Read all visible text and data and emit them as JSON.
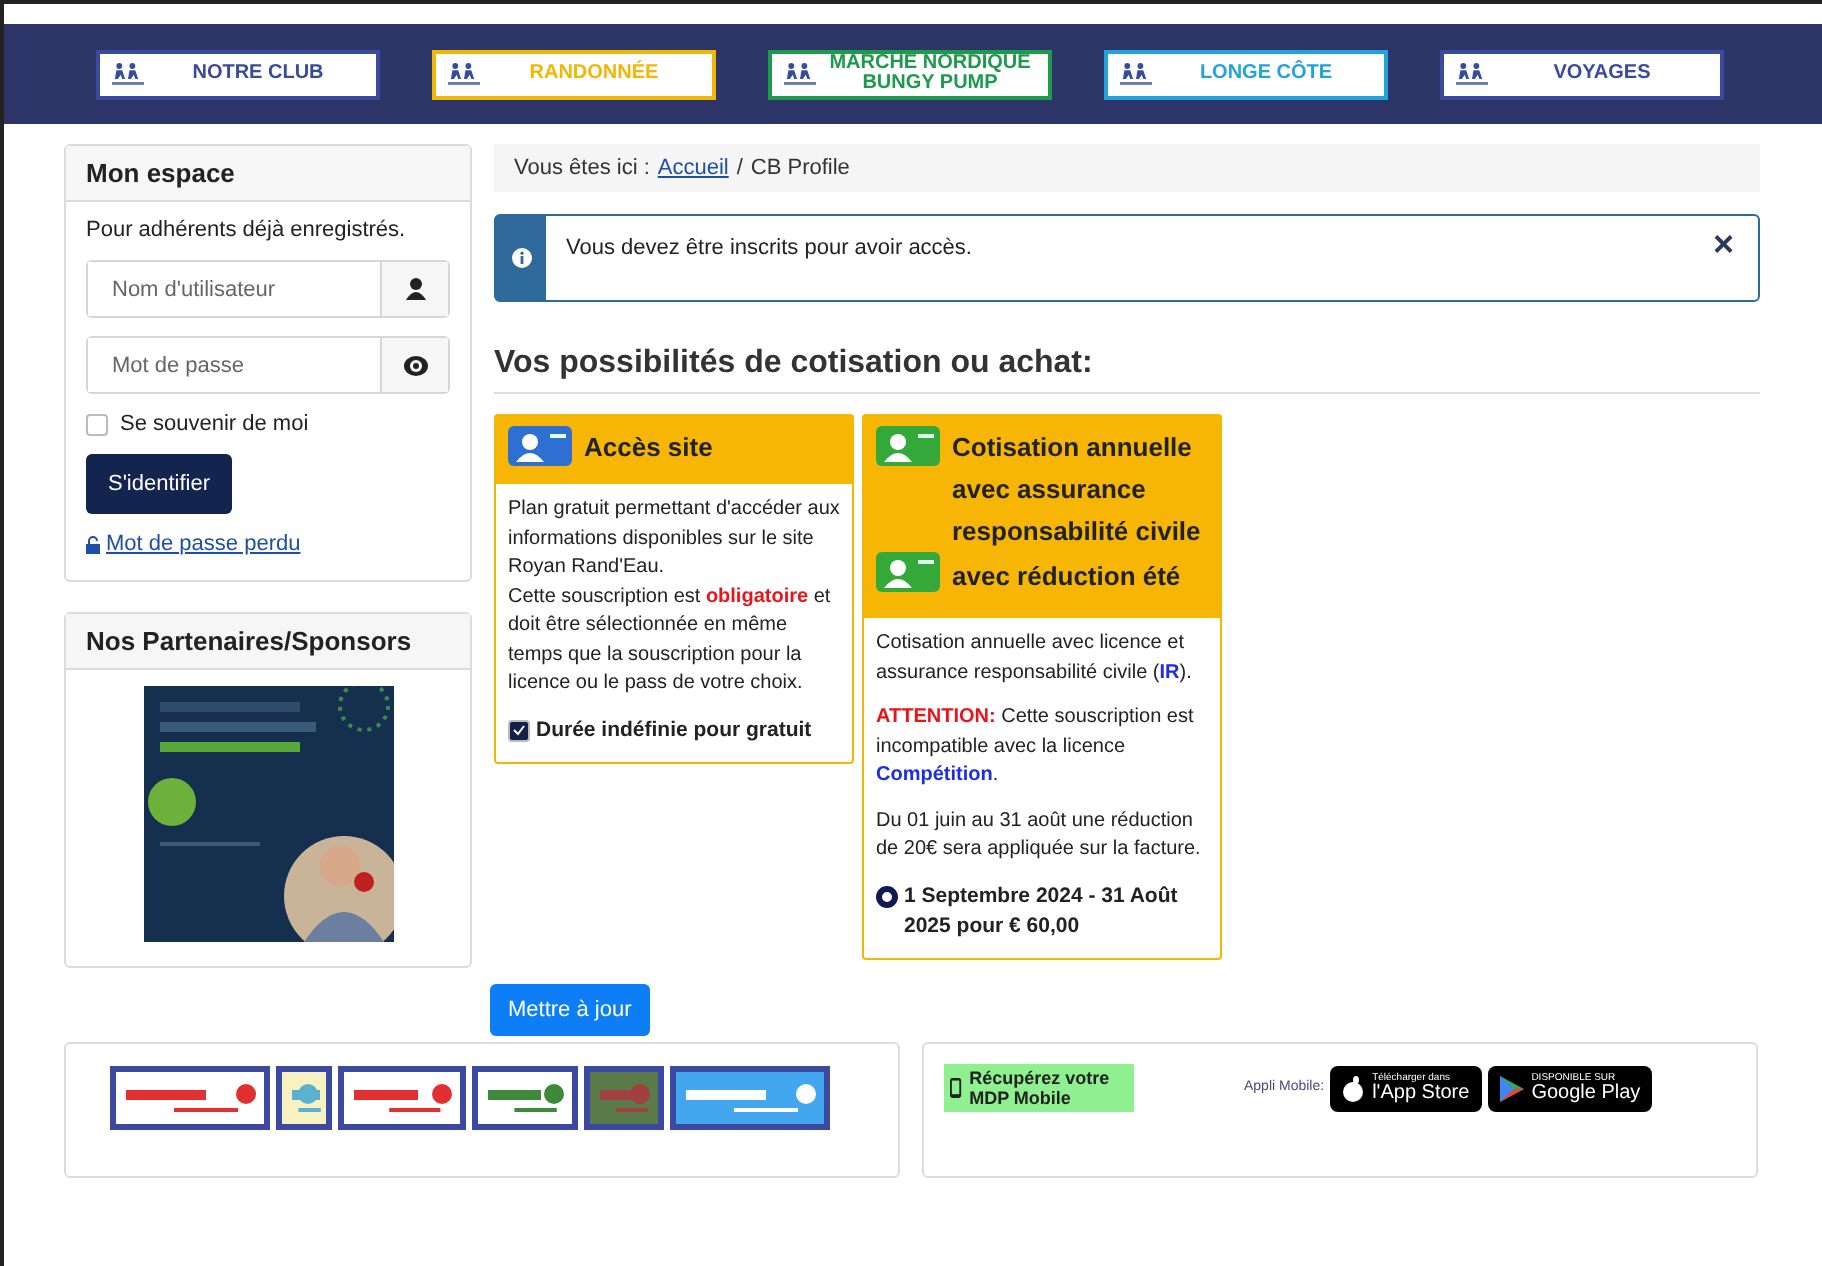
{
  "nav": [
    {
      "label": "NOTRE CLUB",
      "color": "#3a4a9c"
    },
    {
      "label": "RANDONNÉE",
      "color": "#f2b705"
    },
    {
      "label": "MARCHE NORDIQUE BUNGY PUMP",
      "color": "#1e9a4c"
    },
    {
      "label": "LONGE CÔTE",
      "color": "#22a3dc"
    },
    {
      "label": "VOYAGES",
      "color": "#3a4a9c"
    }
  ],
  "login": {
    "title": "Mon espace",
    "intro": "Pour adhérents déjà enregistrés.",
    "username": {
      "placeholder": "Nom d'utilisateur"
    },
    "password": {
      "placeholder": "Mot de passe"
    },
    "remember": {
      "label": "Se souvenir de moi",
      "checked": false
    },
    "submit": "S'identifier",
    "lost_password": "Mot de passe perdu"
  },
  "sponsors": {
    "title": "Nos Partenaires/Sponsors"
  },
  "breadcrumb": {
    "prefix": "Vous êtes ici :",
    "separator": "/",
    "items": [
      {
        "label": "Accueil",
        "kind": "link"
      },
      {
        "label": "CB Profile",
        "kind": "current"
      }
    ]
  },
  "alert": {
    "message": "Vous devez être inscrits pour avoir accès.",
    "close": "×"
  },
  "heading": "Vos possibilités de cotisation ou achat:",
  "plans": [
    {
      "title_parts": [
        "Accès site"
      ],
      "color": "#2e6fd1",
      "paragraphs": [
        {
          "lines": [
            "Plan gratuit permettant d'accéder aux informations disponibles sur le site Royan Rand'Eau.",
            "Cette souscription est **obligatoire** et doit être sélectionnée en  même temps que la souscription pour la licence ou le pass de votre choix."
          ]
        }
      ],
      "option": {
        "kind": "checkbox",
        "label": "Durée indéfinie pour gratuit",
        "selected": true
      }
    },
    {
      "title_parts": [
        "Cotisation annuelle avec assurance responsabilité civile",
        "avec réduction été"
      ],
      "color": "#35a83a",
      "paragraphs": [
        {
          "lines": [
            "Cotisation annuelle avec licence et assurance responsabilité civile (*IR*)."
          ]
        },
        {
          "lines": [
            "**ATTENTION:** Cette souscription est incompatible avec la licence *Compétition*."
          ]
        },
        {
          "lines": [
            "Du 01 juin au 31 août une réduction de 20€ sera appliquée sur la facture."
          ]
        }
      ],
      "option": {
        "kind": "radio",
        "label": "1 Septembre 2024 - 31 Août 2025 pour € 60,00",
        "selected": true
      }
    }
  ],
  "update_button": "Mettre à jour",
  "mobile": {
    "recover": "Récupérez votre MDP Mobile",
    "label": "Appli Mobile:",
    "stores": [
      {
        "kind": "apple",
        "small": "Télécharger dans",
        "big": "l'App Store"
      },
      {
        "kind": "google",
        "small": "DISPONIBLE SUR",
        "big": "Google Play"
      }
    ]
  }
}
